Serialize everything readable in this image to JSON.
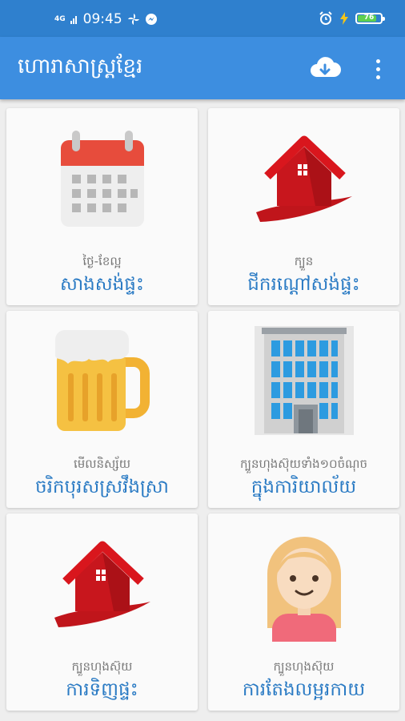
{
  "status": {
    "network": "4G",
    "time": "09:45",
    "battery": "76",
    "battery_level": 0.76
  },
  "appbar": {
    "title": "ហោរាសាស្ត្រខ្មែរ"
  },
  "cards": [
    {
      "sub": "ថ្ងៃ-ខែល្អ",
      "main": "សាងសង់ផ្ទះ",
      "icon": "calendar-icon"
    },
    {
      "sub": "ក្បួន",
      "main": "ជីករណ្ដៅសង់ផ្ទះ",
      "icon": "house-icon"
    },
    {
      "sub": "មើលនិស្ស័យ",
      "main": "ចរិកបុរសស្រវឹងស្រា",
      "icon": "beer-mug-icon"
    },
    {
      "sub": "ក្បួនហុងស៊ុយទាំង១០ចំណុច",
      "main": "ក្នុងការិយាល័យ",
      "icon": "office-building-icon"
    },
    {
      "sub": "ក្បួនហុងស៊ុយ",
      "main": "ការទិញផ្ទះ",
      "icon": "house-icon"
    },
    {
      "sub": "ក្បួនហុងស៊ុយ",
      "main": "ការតែងលម្អរកាយ",
      "icon": "woman-avatar-icon"
    }
  ],
  "colors": {
    "statusbar": "#2f80ce",
    "appbar": "#3d8ee0",
    "card_title": "#2b7bc4"
  }
}
